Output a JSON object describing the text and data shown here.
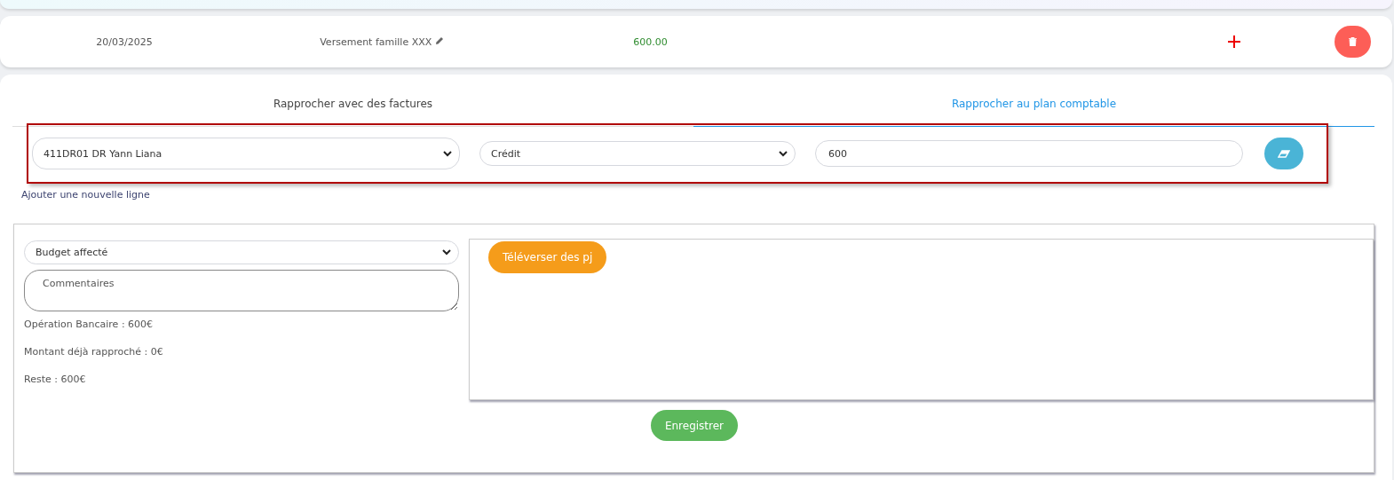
{
  "transaction": {
    "date": "20/03/2025",
    "label": "Versement famille XXX",
    "amount": "600.00"
  },
  "tabs": [
    {
      "label": "Rapprocher avec des factures",
      "selected": false
    },
    {
      "label": "Rapprocher au plan comptable",
      "selected": true
    }
  ],
  "lines": [
    {
      "account": "411DR01 DR Yann Liana",
      "direction": "Crédit",
      "amount": "600",
      "highlighted": true
    }
  ],
  "add_line_link": "Ajouter une nouvelle ligne",
  "budget_select": "Budget affecté",
  "comments": {
    "placeholder": "Commentaires"
  },
  "summary": [
    "Opération Bancaire : 600€",
    "Montant déjà rapproché : 0€",
    "Reste : 600€"
  ],
  "upload_button": "Téléverser des pj",
  "save_button": "Enregistrer"
}
